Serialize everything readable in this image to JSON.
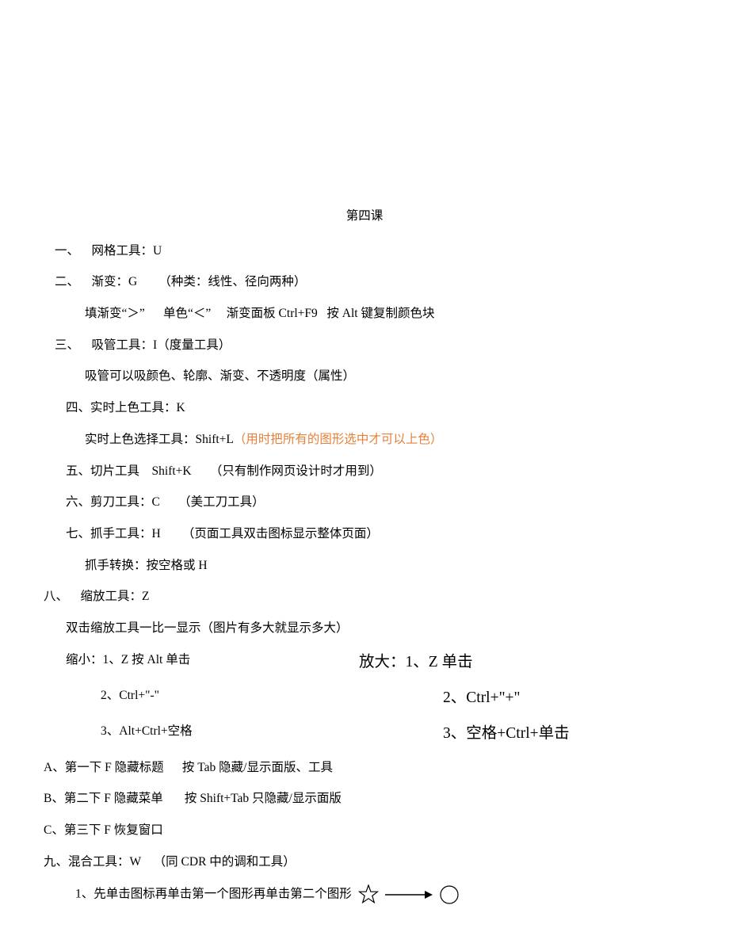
{
  "title": "第四课",
  "lines": {
    "l1": "一、",
    "l1t": "网格工具：",
    "l1u": "U",
    "l2": "二、",
    "l2t": "渐变：",
    "l2g": "G",
    "l2p": "（种类：线性、径向两种）",
    "l2sub": "填渐变“＞”",
    "l2sub2": "单色“＜”",
    "l2sub3_pre": "渐变面板 ",
    "l2sub3_key": "Ctrl+F9",
    "l2sub4_pre": "按 ",
    "l2sub4_key": "Alt ",
    "l2sub4_post": "键复制颜色块",
    "l3": "三、",
    "l3t_pre": "吸管工具：",
    "l3t_key": "I",
    "l3t_post": "（度量工具）",
    "l3sub": "吸管可以吸颜色、轮廓、渐变、不透明度（属性）",
    "l4": "四、实时上色工具：",
    "l4k": "K",
    "l4sub_pre": "实时上色选择工具：",
    "l4sub_key": "Shift+L",
    "l4sub_hl": "（用时把所有的图形选中才可以上色）",
    "l5": "五、切片工具",
    "l5k": "Shift+K",
    "l5p": "（只有制作网页设计时才用到）",
    "l6": "六、剪刀工具：",
    "l6k": "C",
    "l6p": "（美工刀工具）",
    "l7": "七、抓手工具：",
    "l7k": "H",
    "l7p": "（页面工具双击图标显示整体页面）",
    "l7sub": "抓手转换：按空格或 ",
    "l7sub_key": "H",
    "l8": "八、",
    "l8t": "缩放工具：",
    "l8k": "Z",
    "l8sub1": "双击缩放工具一比一显示（图片有多大就显示多大）",
    "sx_label_pre": "缩小：",
    "sx_1_pre": "1、",
    "sx_1_k1": "Z ",
    "sx_1_mid": " 按 ",
    "sx_1_k2": "Alt ",
    "sx_1_post": "单击",
    "sx_2_pre": "2、",
    "sx_2_key": "Ctrl+\"-\"",
    "sx_3_pre": "3、",
    "sx_3_key": "Alt+Ctrl+",
    "sx_3_post": "空格",
    "fd_label_pre": "放大：",
    "fd_1_pre": "1、",
    "fd_1_k": "Z ",
    "fd_1_post": " 单击",
    "fd_2_pre": "2、",
    "fd_2_key": "Ctrl+\"+\"",
    "fd_3_pre": "3、",
    "fd_3_mid_a": "空格",
    "fd_3_kp": "+Ctrl+",
    "fd_3_post": "单击",
    "la_pre": "A",
    "la": "、第一下 ",
    "la_k": "F",
    "la_t": " 隐藏标题",
    "la_mid_pre": "按 ",
    "la_mid_key": "Tab ",
    "la_mid_post": "隐藏/显示面版、工具",
    "lb_pre": "B",
    "lb": "、第二下 ",
    "lb_k": "F",
    "lb_t": " 隐藏菜单",
    "lb_mid_pre": "按 ",
    "lb_mid_key": "Shift+Tab ",
    "lb_mid_post": "只隐藏/显示面版",
    "lc_pre": "C",
    "lc": "、第三下 ",
    "lc_k": "F",
    "lc_t": " 恢复窗口",
    "l9": "九、混合工具：",
    "l9k": "W",
    "l9_post_pre": "（同 ",
    "l9_post_key": "CDR ",
    "l9_post_suf": "中的调和工具）",
    "l9sub_pre": "1、",
    "l9sub": "先单击图标再单击第一个图形再单击第二个图形"
  }
}
